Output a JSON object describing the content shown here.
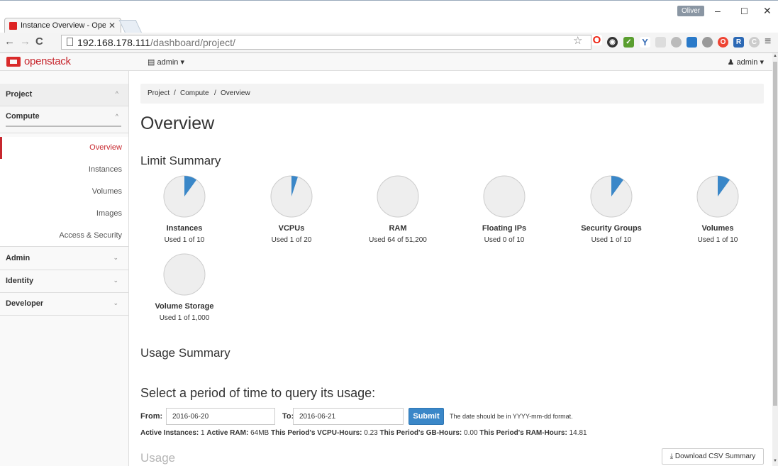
{
  "browser": {
    "tab_title": "Instance Overview - Open",
    "url_host": "192.168.178.111",
    "url_path": "/dashboard/project/",
    "user_badge": "Oliver",
    "colors": {
      "accent": "#c7272e",
      "primary_button": "#3a87c8",
      "chart_fill": "#3a87c8",
      "chart_bg": "#eeeeee"
    }
  },
  "header": {
    "brand": "openstack",
    "project_selector": "admin ▾",
    "user_menu": "admin ▾"
  },
  "sidebar": {
    "project": "Project",
    "compute": "Compute",
    "items": [
      {
        "label": "Overview",
        "active": true
      },
      {
        "label": "Instances",
        "active": false
      },
      {
        "label": "Volumes",
        "active": false
      },
      {
        "label": "Images",
        "active": false
      },
      {
        "label": "Access & Security",
        "active": false
      }
    ],
    "admin": "Admin",
    "identity": "Identity",
    "developer": "Developer"
  },
  "breadcrumb": {
    "project": "Project",
    "compute": "Compute",
    "overview": "Overview"
  },
  "page": {
    "title": "Overview",
    "limit_summary": "Limit Summary",
    "usage_summary": "Usage Summary",
    "query_title": "Select a period of time to query its usage:",
    "usage_title": "Usage"
  },
  "chart_data": {
    "type": "pie",
    "items": [
      {
        "name": "Instances",
        "label": "Used 1 of 10",
        "used": 1,
        "total": 10
      },
      {
        "name": "VCPUs",
        "label": "Used 1 of 20",
        "used": 1,
        "total": 20
      },
      {
        "name": "RAM",
        "label": "Used 64 of 51,200",
        "used": 64,
        "total": 51200
      },
      {
        "name": "Floating IPs",
        "label": "Used 0 of 10",
        "used": 0,
        "total": 10
      },
      {
        "name": "Security Groups",
        "label": "Used 1 of 10",
        "used": 1,
        "total": 10
      },
      {
        "name": "Volumes",
        "label": "Used 1 of 10",
        "used": 1,
        "total": 10
      },
      {
        "name": "Volume Storage",
        "label": "Used 1 of 1,000",
        "used": 1,
        "total": 1000
      }
    ]
  },
  "form": {
    "from_label": "From:",
    "from_value": "2016-06-20",
    "to_label": "To:",
    "to_value": "2016-06-21",
    "submit": "Submit",
    "hint": "The date should be in YYYY-mm-dd format."
  },
  "stats": {
    "active_instances_label": "Active Instances:",
    "active_instances": "1",
    "active_ram_label": "Active RAM:",
    "active_ram": "64MB",
    "vcpu_hours_label": "This Period's VCPU-Hours:",
    "vcpu_hours": "0.23",
    "gb_hours_label": "This Period's GB-Hours:",
    "gb_hours": "0.00",
    "ram_hours_label": "This Period's RAM-Hours:",
    "ram_hours": "14.81"
  },
  "csv_button": "Download CSV Summary"
}
